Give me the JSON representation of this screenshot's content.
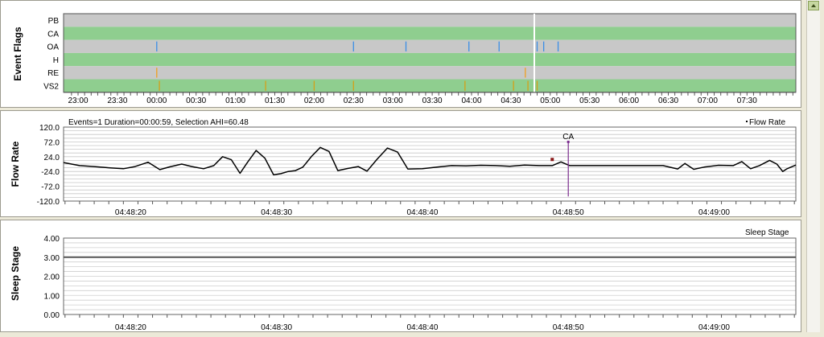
{
  "chart_data": [
    {
      "type": "event-timeline",
      "ylabel": "Event Flags",
      "rows": [
        "PB",
        "CA",
        "OA",
        "H",
        "RE",
        "VS2"
      ],
      "row_colors": [
        "#c8c8c8",
        "#8fce8f",
        "#c8c8c8",
        "#8fce8f",
        "#c8c8c8",
        "#8fce8f"
      ],
      "tick_labels": [
        "23:00",
        "23:30",
        "00:00",
        "00:30",
        "01:00",
        "01:30",
        "02:00",
        "02:30",
        "03:00",
        "03:30",
        "04:00",
        "04:30",
        "05:00",
        "05:30",
        "06:00",
        "06:30",
        "07:00",
        "07:30"
      ],
      "cursor_time": "04:48:50",
      "events": [
        {
          "row": "CA",
          "time": "04:48",
          "color": "#2e5e2e"
        },
        {
          "row": "OA",
          "time": "00:00",
          "color": "#3a8ee6"
        },
        {
          "row": "OA",
          "time": "02:30",
          "color": "#3a8ee6"
        },
        {
          "row": "OA",
          "time": "03:10",
          "color": "#3a8ee6"
        },
        {
          "row": "OA",
          "time": "03:58",
          "color": "#3a8ee6"
        },
        {
          "row": "OA",
          "time": "04:21",
          "color": "#3a8ee6"
        },
        {
          "row": "OA",
          "time": "04:50",
          "color": "#3a8ee6"
        },
        {
          "row": "OA",
          "time": "04:55",
          "color": "#3a8ee6"
        },
        {
          "row": "OA",
          "time": "05:06",
          "color": "#3a8ee6"
        },
        {
          "row": "RE",
          "time": "00:00",
          "color": "#f0a020"
        },
        {
          "row": "RE",
          "time": "04:41",
          "color": "#f0a020"
        },
        {
          "row": "VS2",
          "time": "00:02",
          "color": "#d4a017"
        },
        {
          "row": "VS2",
          "time": "01:23",
          "color": "#d4a017"
        },
        {
          "row": "VS2",
          "time": "02:00",
          "color": "#d4a017"
        },
        {
          "row": "VS2",
          "time": "02:30",
          "color": "#d4a017"
        },
        {
          "row": "VS2",
          "time": "03:55",
          "color": "#d4a017"
        },
        {
          "row": "VS2",
          "time": "04:32",
          "color": "#d4a017"
        },
        {
          "row": "VS2",
          "time": "04:43",
          "color": "#d4a017"
        },
        {
          "row": "VS2",
          "time": "04:50",
          "color": "#d4a017"
        }
      ]
    },
    {
      "type": "line",
      "ylabel": "Flow Rate",
      "info": "Events=1 Duration=00:00:59, Selection AHI=60.48",
      "legend": "Flow Rate",
      "ylim": [
        -120,
        120
      ],
      "y_ticks": [
        "120.0",
        "72.0",
        "24.0",
        "-24.0",
        "-72.0",
        "-120.0"
      ],
      "x_labels": [
        "04:48:20",
        "04:48:30",
        "04:48:40",
        "04:48:50",
        "04:49:00"
      ],
      "xlim": [
        "04:48:15.4",
        "04:49:05.6"
      ],
      "annotation": {
        "label": "CA",
        "time": "04:48:50"
      },
      "x": [
        15.4,
        16.5,
        17.5,
        18.5,
        19.5,
        20.3,
        21.2,
        22.0,
        22.7,
        23.5,
        24.2,
        25.0,
        25.7,
        26.3,
        26.9,
        27.5,
        28.0,
        28.6,
        29.2,
        29.8,
        30.3,
        30.8,
        31.3,
        31.8,
        32.4,
        33.0,
        33.6,
        34.2,
        34.9,
        35.6,
        36.2,
        36.9,
        37.6,
        38.3,
        39.0,
        40.0,
        41.0,
        42.0,
        43.0,
        44.0,
        45.0,
        46.0,
        47.0,
        48.0,
        48.9,
        49.5,
        50.1,
        50.5,
        51.0,
        52.0,
        53.5,
        55.0,
        56.5,
        57.5,
        58.0,
        58.6,
        59.3,
        60.3,
        61.3,
        61.9,
        62.5,
        63.1,
        63.8,
        64.3,
        64.7,
        65.0,
        65.6
      ],
      "y": [
        5,
        -5,
        -8,
        -12,
        -15,
        -8,
        6,
        -18,
        -9,
        0,
        -8,
        -15,
        -5,
        24,
        14,
        -30,
        5,
        44,
        19,
        -35,
        -31,
        -24,
        -21,
        -10,
        25,
        54,
        41,
        -21,
        -14,
        -8,
        -23,
        16,
        52,
        39,
        -16,
        -15,
        -10,
        -5,
        -6,
        -4,
        -5,
        -7,
        -3,
        -5,
        -5,
        7,
        -5,
        -5,
        -5,
        -5,
        -5,
        -5,
        -5,
        -16,
        2,
        -17,
        -10,
        -4,
        -5,
        8,
        -15,
        -5,
        12,
        0,
        -24,
        -15,
        -3
      ]
    },
    {
      "type": "line",
      "ylabel": "Sleep Stage",
      "legend": "Sleep Stage",
      "ylim": [
        0,
        4
      ],
      "y_ticks": [
        "4.00",
        "3.00",
        "2.00",
        "1.00",
        "0.00"
      ],
      "x_labels": [
        "04:48:20",
        "04:48:30",
        "04:48:40",
        "04:48:50",
        "04:49:00"
      ],
      "xlim": [
        "04:48:15.4",
        "04:49:05.6"
      ],
      "x": [
        15.4,
        65.6
      ],
      "y": [
        3,
        3
      ]
    }
  ]
}
